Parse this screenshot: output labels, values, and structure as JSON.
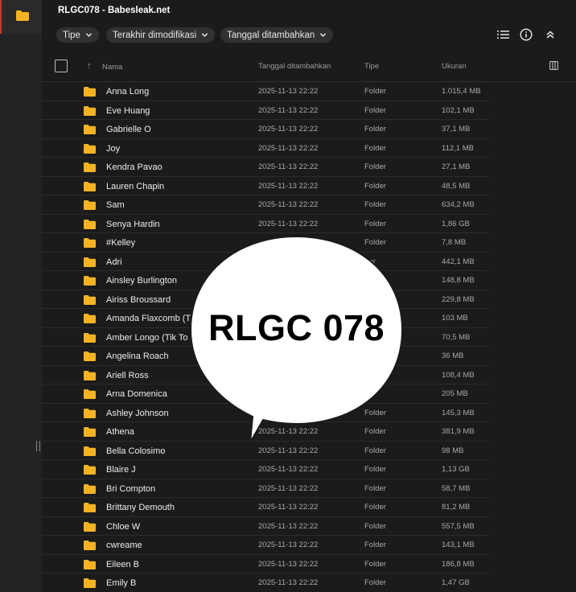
{
  "title": "RLGC078 - Babesleak.net",
  "filters": [
    {
      "label": "Tipe"
    },
    {
      "label": "Terakhir dimodifikasi"
    },
    {
      "label": "Tanggal ditambahkan"
    }
  ],
  "columns": {
    "name": "Nama",
    "date": "Tanggal ditambahkan",
    "type": "Tipe",
    "size": "Ukuran"
  },
  "rows": [
    {
      "name": "Anna Long",
      "date": "2025-11-13 22:22",
      "type": "Folder",
      "size": "1.015,4 MB"
    },
    {
      "name": "Eve Huang",
      "date": "2025-11-13 22:22",
      "type": "Folder",
      "size": "102,1 MB"
    },
    {
      "name": "Gabrielle O",
      "date": "2025-11-13 22:22",
      "type": "Folder",
      "size": "37,1 MB"
    },
    {
      "name": "Joy",
      "date": "2025-11-13 22:22",
      "type": "Folder",
      "size": "112,1 MB"
    },
    {
      "name": "Kendra Pavao",
      "date": "2025-11-13 22:22",
      "type": "Folder",
      "size": "27,1 MB"
    },
    {
      "name": "Lauren Chapin",
      "date": "2025-11-13 22:22",
      "type": "Folder",
      "size": "48,5 MB"
    },
    {
      "name": "Sam",
      "date": "2025-11-13 22:22",
      "type": "Folder",
      "size": "634,2 MB"
    },
    {
      "name": "Senya Hardin",
      "date": "2025-11-13 22:22",
      "type": "Folder",
      "size": "1,86 GB"
    },
    {
      "name": "#Kelley",
      "date": "",
      "type": "Folder",
      "size": "7,8 MB"
    },
    {
      "name": "Adri",
      "date": "",
      "type": "der",
      "size": "442,1 MB"
    },
    {
      "name": "Ainsley Burlington",
      "date": "",
      "type": "",
      "size": "148,8 MB"
    },
    {
      "name": "Airiss Broussard",
      "date": "",
      "type": "",
      "size": "229,8 MB"
    },
    {
      "name": "Amanda Flaxcomb (T",
      "date": "",
      "type": "",
      "size": "103 MB"
    },
    {
      "name": "Amber Longo (Tik To",
      "date": "",
      "type": "",
      "size": "70,5 MB"
    },
    {
      "name": "Angelina Roach",
      "date": "",
      "type": "",
      "size": "36 MB"
    },
    {
      "name": "Ariell Ross",
      "date": "",
      "type": "",
      "size": "108,4 MB"
    },
    {
      "name": "Arna Domenica",
      "date": "",
      "type": "er",
      "size": "205 MB"
    },
    {
      "name": "Ashley Johnson",
      "date": "",
      "type": "Folder",
      "size": "145,3 MB"
    },
    {
      "name": "Athena",
      "date": "2025-11-13 22:22",
      "type": "Folder",
      "size": "381,9 MB"
    },
    {
      "name": "Bella Colosimo",
      "date": "2025-11-13 22:22",
      "type": "Folder",
      "size": "98 MB"
    },
    {
      "name": "Blaire J",
      "date": "2025-11-13 22:22",
      "type": "Folder",
      "size": "1,13 GB"
    },
    {
      "name": "Bri Compton",
      "date": "2025-11-13 22:22",
      "type": "Folder",
      "size": "58,7 MB"
    },
    {
      "name": "Brittany Demouth",
      "date": "2025-11-13 22:22",
      "type": "Folder",
      "size": "81,2 MB"
    },
    {
      "name": "Chloe W",
      "date": "2025-11-13 22:22",
      "type": "Folder",
      "size": "557,5 MB"
    },
    {
      "name": "cwreame",
      "date": "2025-11-13 22:22",
      "type": "Folder",
      "size": "143,1 MB"
    },
    {
      "name": "Eileen B",
      "date": "2025-11-13 22:22",
      "type": "Folder",
      "size": "186,8 MB"
    },
    {
      "name": "Emily B",
      "date": "2025-11-13 22:22",
      "type": "Folder",
      "size": "1,47 GB"
    }
  ],
  "overlay": {
    "text": "RLGC 078"
  },
  "colors": {
    "folder": "#f5b324",
    "accent": "#c0392b",
    "background": "#1b1b1b"
  },
  "icons": [
    "folder-icon",
    "chevron-down-icon",
    "list-view-icon",
    "info-icon",
    "collapse-icon",
    "sort-up-icon",
    "columns-icon"
  ]
}
